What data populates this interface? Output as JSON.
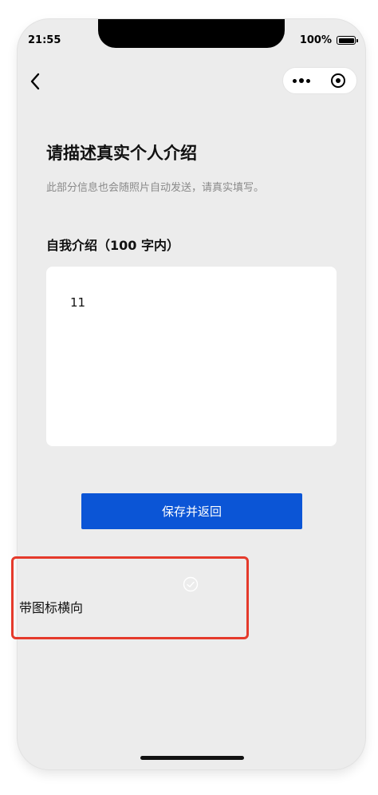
{
  "status_bar": {
    "time": "21:55",
    "battery": "100%"
  },
  "nav": {
    "back_icon": "chevron-left-icon",
    "more_icon": "more-dots-icon",
    "close_icon": "target-circle-icon"
  },
  "header": {
    "title": "请描述真实个人介绍",
    "subtitle": "此部分信息也会随照片自动发送，请真实填写。"
  },
  "intro": {
    "label": "自我介绍（100 字内）",
    "value": "11"
  },
  "actions": {
    "save_label": "保存并返回"
  },
  "annotation": {
    "label": "带图标横向",
    "icon": "check-circle-icon"
  },
  "colors": {
    "primary": "#0b55d6",
    "background": "#ececec",
    "annotation_border": "#e53a2b",
    "subtitle": "#8a8a8a"
  }
}
